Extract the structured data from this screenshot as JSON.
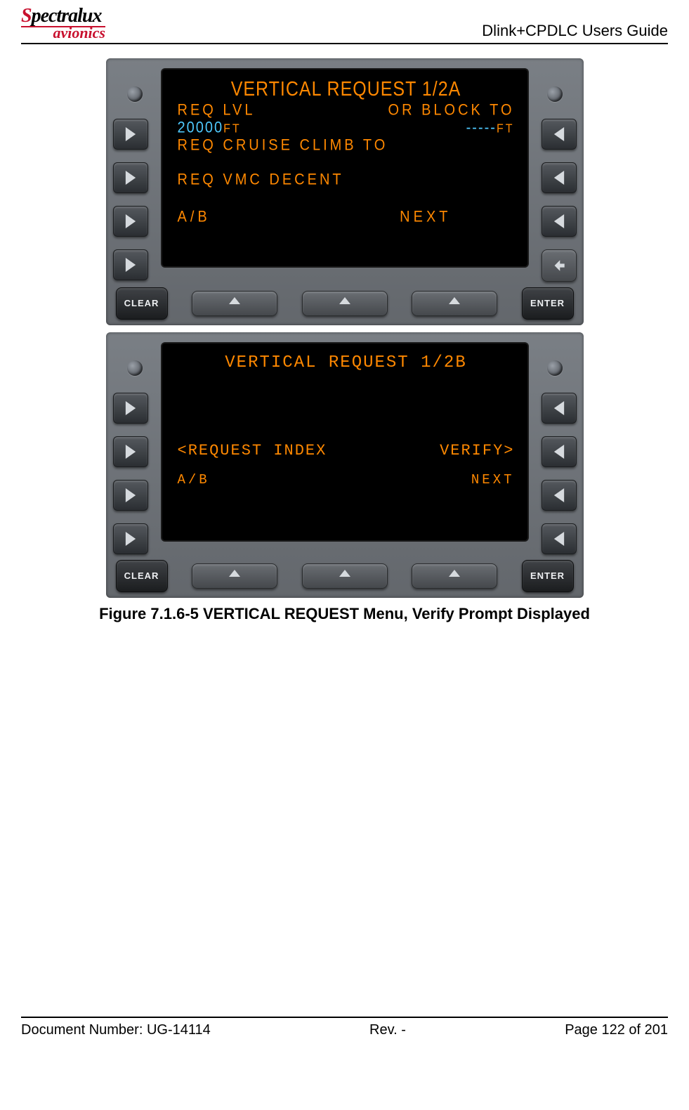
{
  "header": {
    "logo_top": "Spectralux",
    "logo_bottom": "avionics",
    "doc_title": "Dlink+CPDLC Users Guide"
  },
  "device1": {
    "screen": {
      "title": "VERTICAL REQUEST 1/2A",
      "r1_left": "REQ LVL",
      "r1_right": "OR BLOCK TO",
      "r2_left_val": "20000",
      "r2_left_unit": "FT",
      "r2_right_dash": "-----",
      "r2_right_unit": "FT",
      "r3": "REQ CRUISE CLIMB TO",
      "r4": "REQ VMC DECENT",
      "f_left": "A/B",
      "f_right": "NEXT"
    },
    "buttons": {
      "clear": "CLEAR",
      "enter": "ENTER"
    }
  },
  "device2": {
    "screen": {
      "title": "VERTICAL REQUEST 1/2B",
      "r_left": "<REQUEST INDEX",
      "r_right": "VERIFY>",
      "f_left": "A/B",
      "f_right": "NEXT"
    },
    "buttons": {
      "clear": "CLEAR",
      "enter": "ENTER"
    }
  },
  "caption": "Figure 7.1.6-5 VERTICAL REQUEST Menu, Verify Prompt Displayed",
  "footer": {
    "left": "Document Number:  UG-14114",
    "center": "Rev. -",
    "right": "Page 122 of 201"
  }
}
